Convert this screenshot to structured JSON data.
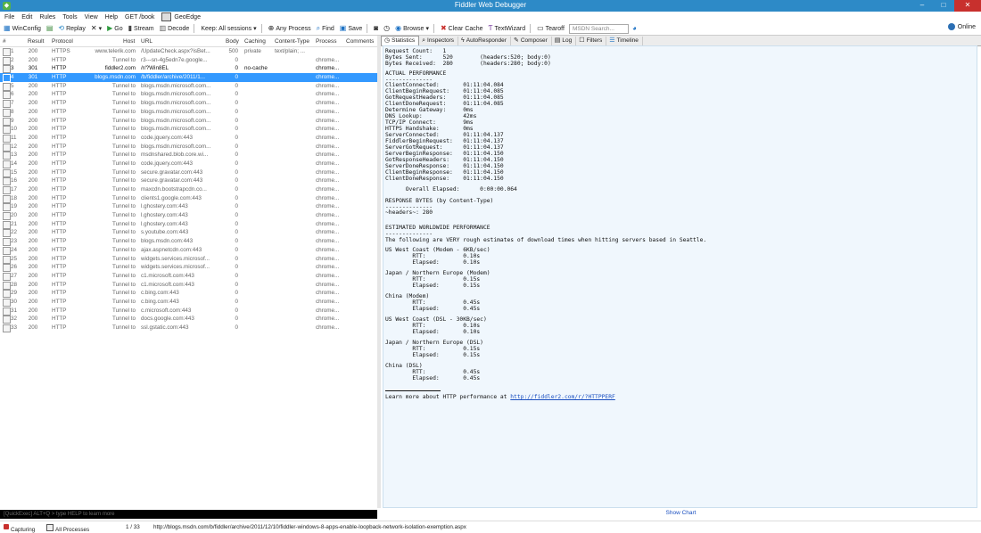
{
  "window": {
    "title": "Fiddler Web Debugger"
  },
  "menu": [
    "File",
    "Edit",
    "Rules",
    "Tools",
    "View",
    "Help",
    "GET /book",
    "GeoEdge"
  ],
  "toolbar": {
    "winconfig": "WinConfig",
    "replay": "Replay",
    "go": "Go",
    "stream": "Stream",
    "decode": "Decode",
    "keep": "Keep: All sessions",
    "any_process": "Any Process",
    "find": "Find",
    "save": "Save",
    "browse": "Browse",
    "clear_cache": "Clear Cache",
    "textwizard": "TextWizard",
    "tearoff": "Tearoff",
    "search_placeholder": "MSDN Search...",
    "online": "Online"
  },
  "sessions": {
    "columns": {
      "num": "#",
      "result": "Result",
      "protocol": "Protocol",
      "host": "Host",
      "url": "URL",
      "body": "Body",
      "caching": "Caching",
      "content_type": "Content-Type",
      "process": "Process",
      "comments": "Comments"
    },
    "rows": [
      {
        "id": "1",
        "result": "200",
        "protocol": "HTTPS",
        "host": "www.telerik.com",
        "url": "/UpdateCheck.aspx?isBet...",
        "body": "500",
        "caching": "private",
        "ctype": "text/plain; ...",
        "process": "",
        "style": ""
      },
      {
        "id": "2",
        "result": "200",
        "protocol": "HTTP",
        "host": "Tunnel to",
        "url": "r3---sn-4g5edn7e.google...",
        "body": "0",
        "caching": "",
        "ctype": "",
        "process": "chrome...",
        "style": ""
      },
      {
        "id": "3",
        "result": "301",
        "protocol": "HTTP",
        "host": "fiddler2.com",
        "url": "/r/?Win8EL",
        "body": "0",
        "caching": "no-cache",
        "ctype": "",
        "process": "chrome...",
        "style": "black"
      },
      {
        "id": "4",
        "result": "301",
        "protocol": "HTTP",
        "host": "blogs.msdn.com",
        "url": "/b/fiddler/archive/2011/1...",
        "body": "0",
        "caching": "",
        "ctype": "",
        "process": "chrome...",
        "style": "sel"
      },
      {
        "id": "5",
        "result": "200",
        "protocol": "HTTP",
        "host": "Tunnel to",
        "url": "blogs.msdn.microsoft.com...",
        "body": "0",
        "caching": "",
        "ctype": "",
        "process": "chrome...",
        "style": ""
      },
      {
        "id": "6",
        "result": "200",
        "protocol": "HTTP",
        "host": "Tunnel to",
        "url": "blogs.msdn.microsoft.com...",
        "body": "0",
        "caching": "",
        "ctype": "",
        "process": "chrome...",
        "style": ""
      },
      {
        "id": "7",
        "result": "200",
        "protocol": "HTTP",
        "host": "Tunnel to",
        "url": "blogs.msdn.microsoft.com...",
        "body": "0",
        "caching": "",
        "ctype": "",
        "process": "chrome...",
        "style": ""
      },
      {
        "id": "8",
        "result": "200",
        "protocol": "HTTP",
        "host": "Tunnel to",
        "url": "blogs.msdn.microsoft.com...",
        "body": "0",
        "caching": "",
        "ctype": "",
        "process": "chrome...",
        "style": ""
      },
      {
        "id": "9",
        "result": "200",
        "protocol": "HTTP",
        "host": "Tunnel to",
        "url": "blogs.msdn.microsoft.com...",
        "body": "0",
        "caching": "",
        "ctype": "",
        "process": "chrome...",
        "style": ""
      },
      {
        "id": "10",
        "result": "200",
        "protocol": "HTTP",
        "host": "Tunnel to",
        "url": "blogs.msdn.microsoft.com...",
        "body": "0",
        "caching": "",
        "ctype": "",
        "process": "chrome...",
        "style": ""
      },
      {
        "id": "11",
        "result": "200",
        "protocol": "HTTP",
        "host": "Tunnel to",
        "url": "code.jquery.com:443",
        "body": "0",
        "caching": "",
        "ctype": "",
        "process": "chrome...",
        "style": ""
      },
      {
        "id": "12",
        "result": "200",
        "protocol": "HTTP",
        "host": "Tunnel to",
        "url": "blogs.msdn.microsoft.com...",
        "body": "0",
        "caching": "",
        "ctype": "",
        "process": "chrome...",
        "style": ""
      },
      {
        "id": "13",
        "result": "200",
        "protocol": "HTTP",
        "host": "Tunnel to",
        "url": "msdnshared.blob.core.wi...",
        "body": "0",
        "caching": "",
        "ctype": "",
        "process": "chrome...",
        "style": ""
      },
      {
        "id": "14",
        "result": "200",
        "protocol": "HTTP",
        "host": "Tunnel to",
        "url": "code.jquery.com:443",
        "body": "0",
        "caching": "",
        "ctype": "",
        "process": "chrome...",
        "style": ""
      },
      {
        "id": "15",
        "result": "200",
        "protocol": "HTTP",
        "host": "Tunnel to",
        "url": "secure.gravatar.com:443",
        "body": "0",
        "caching": "",
        "ctype": "",
        "process": "chrome...",
        "style": ""
      },
      {
        "id": "16",
        "result": "200",
        "protocol": "HTTP",
        "host": "Tunnel to",
        "url": "secure.gravatar.com:443",
        "body": "0",
        "caching": "",
        "ctype": "",
        "process": "chrome...",
        "style": ""
      },
      {
        "id": "17",
        "result": "200",
        "protocol": "HTTP",
        "host": "Tunnel to",
        "url": "maxcdn.bootstrapcdn.co...",
        "body": "0",
        "caching": "",
        "ctype": "",
        "process": "chrome...",
        "style": ""
      },
      {
        "id": "18",
        "result": "200",
        "protocol": "HTTP",
        "host": "Tunnel to",
        "url": "clients1.google.com:443",
        "body": "0",
        "caching": "",
        "ctype": "",
        "process": "chrome...",
        "style": ""
      },
      {
        "id": "19",
        "result": "200",
        "protocol": "HTTP",
        "host": "Tunnel to",
        "url": "l.ghostery.com:443",
        "body": "0",
        "caching": "",
        "ctype": "",
        "process": "chrome...",
        "style": ""
      },
      {
        "id": "20",
        "result": "200",
        "protocol": "HTTP",
        "host": "Tunnel to",
        "url": "l.ghostery.com:443",
        "body": "0",
        "caching": "",
        "ctype": "",
        "process": "chrome...",
        "style": ""
      },
      {
        "id": "21",
        "result": "200",
        "protocol": "HTTP",
        "host": "Tunnel to",
        "url": "l.ghostery.com:443",
        "body": "0",
        "caching": "",
        "ctype": "",
        "process": "chrome...",
        "style": ""
      },
      {
        "id": "22",
        "result": "200",
        "protocol": "HTTP",
        "host": "Tunnel to",
        "url": "s.youtube.com:443",
        "body": "0",
        "caching": "",
        "ctype": "",
        "process": "chrome...",
        "style": ""
      },
      {
        "id": "23",
        "result": "200",
        "protocol": "HTTP",
        "host": "Tunnel to",
        "url": "blogs.msdn.com:443",
        "body": "0",
        "caching": "",
        "ctype": "",
        "process": "chrome...",
        "style": ""
      },
      {
        "id": "24",
        "result": "200",
        "protocol": "HTTP",
        "host": "Tunnel to",
        "url": "ajax.aspnetcdn.com:443",
        "body": "0",
        "caching": "",
        "ctype": "",
        "process": "chrome...",
        "style": ""
      },
      {
        "id": "25",
        "result": "200",
        "protocol": "HTTP",
        "host": "Tunnel to",
        "url": "widgets.services.microsof...",
        "body": "0",
        "caching": "",
        "ctype": "",
        "process": "chrome...",
        "style": ""
      },
      {
        "id": "26",
        "result": "200",
        "protocol": "HTTP",
        "host": "Tunnel to",
        "url": "widgets.services.microsof...",
        "body": "0",
        "caching": "",
        "ctype": "",
        "process": "chrome...",
        "style": ""
      },
      {
        "id": "27",
        "result": "200",
        "protocol": "HTTP",
        "host": "Tunnel to",
        "url": "c1.microsoft.com:443",
        "body": "0",
        "caching": "",
        "ctype": "",
        "process": "chrome...",
        "style": ""
      },
      {
        "id": "28",
        "result": "200",
        "protocol": "HTTP",
        "host": "Tunnel to",
        "url": "c1.microsoft.com:443",
        "body": "0",
        "caching": "",
        "ctype": "",
        "process": "chrome...",
        "style": ""
      },
      {
        "id": "29",
        "result": "200",
        "protocol": "HTTP",
        "host": "Tunnel to",
        "url": "c.bing.com:443",
        "body": "0",
        "caching": "",
        "ctype": "",
        "process": "chrome...",
        "style": ""
      },
      {
        "id": "30",
        "result": "200",
        "protocol": "HTTP",
        "host": "Tunnel to",
        "url": "c.bing.com:443",
        "body": "0",
        "caching": "",
        "ctype": "",
        "process": "chrome...",
        "style": ""
      },
      {
        "id": "31",
        "result": "200",
        "protocol": "HTTP",
        "host": "Tunnel to",
        "url": "c.microsoft.com:443",
        "body": "0",
        "caching": "",
        "ctype": "",
        "process": "chrome...",
        "style": ""
      },
      {
        "id": "32",
        "result": "200",
        "protocol": "HTTP",
        "host": "Tunnel to",
        "url": "docs.google.com:443",
        "body": "0",
        "caching": "",
        "ctype": "",
        "process": "chrome...",
        "style": ""
      },
      {
        "id": "33",
        "result": "200",
        "protocol": "HTTP",
        "host": "Tunnel to",
        "url": "ssl.gstatic.com:443",
        "body": "0",
        "caching": "",
        "ctype": "",
        "process": "chrome...",
        "style": ""
      }
    ]
  },
  "quickexec": "[QuickExec] ALT+Q > type HELP to learn more",
  "inspector_tabs": [
    "Statistics",
    "Inspectors",
    "AutoResponder",
    "Composer",
    "Log",
    "Filters",
    "Timeline"
  ],
  "stats": {
    "req_count": "Request Count:   1",
    "bytes_sent": "Bytes Sent:      520        (headers:520; body:0)",
    "bytes_received": "Bytes Received:  280        (headers:280; body:0)",
    "actual_title": "ACTUAL PERFORMANCE",
    "dash1": "--------------",
    "client_connected": "ClientConnected:       01:11:04.084",
    "client_begin_request": "ClientBeginRequest:    01:11:04.085",
    "got_request_headers": "GotRequestHeaders:     01:11:04.085",
    "client_done_request": "ClientDoneRequest:     01:11:04.085",
    "determine_gateway": "Determine Gateway:     0ms",
    "dns_lookup": "DNS Lookup:            42ms",
    "tcpip_connect": "TCP/IP Connect:        9ms",
    "https_handshake": "HTTPS Handshake:       0ms",
    "server_connected": "ServerConnected:       01:11:04.137",
    "fiddler_begin_request": "FiddlerBeginRequest:   01:11:04.137",
    "server_got_request": "ServerGotRequest:      01:11:04.137",
    "server_begin_response": "ServerBeginResponse:   01:11:04.150",
    "got_response_headers": "GotResponseHeaders:    01:11:04.150",
    "server_done_response": "ServerDoneResponse:    01:11:04.150",
    "client_begin_response": "ClientBeginResponse:   01:11:04.150",
    "client_done_response": "ClientDoneResponse:    01:11:04.150",
    "overall_elapsed": "      Overall Elapsed:      0:00:00.064",
    "bytes_title": "RESPONSE BYTES (by Content-Type)",
    "dash2": "--------------",
    "headers_bytes": "~headers~: 280",
    "est_title": "ESTIMATED WORLDWIDE PERFORMANCE",
    "dash3": "--------------",
    "est_note": "The following are VERY rough estimates of download times when hitting servers based in Seattle.",
    "us_modem": "US West Coast (Modem - 6KB/sec)",
    "us_modem_rtt": "        RTT:           0.10s",
    "us_modem_elapsed": "        Elapsed:       0.10s",
    "jp_modem": "Japan / Northern Europe (Modem)",
    "jp_modem_rtt": "        RTT:           0.15s",
    "jp_modem_elapsed": "        Elapsed:       0.15s",
    "cn_modem": "China (Modem)",
    "cn_modem_rtt": "        RTT:           0.45s",
    "cn_modem_elapsed": "        Elapsed:       0.45s",
    "us_dsl": "US West Coast (DSL - 30KB/sec)",
    "us_dsl_rtt": "        RTT:           0.10s",
    "us_dsl_elapsed": "        Elapsed:       0.10s",
    "jp_dsl": "Japan / Northern Europe (DSL)",
    "jp_dsl_rtt": "        RTT:           0.15s",
    "jp_dsl_elapsed": "        Elapsed:       0.15s",
    "cn_dsl": "China (DSL)",
    "cn_dsl_rtt": "        RTT:           0.45s",
    "cn_dsl_elapsed": "        Elapsed:       0.45s",
    "learn_more": "Learn more about HTTP performance at ",
    "learn_link": "http://fiddler2.com/r/?HTTPPERF"
  },
  "show_chart": "Show Chart",
  "status": {
    "capturing": "Capturing",
    "processes": "All Processes",
    "count": "1 / 33",
    "url": "http://blogs.msdn.com/b/fiddler/archive/2011/12/10/fiddler-windows-8-apps-enable-loopback-network-isolation-exemption.aspx"
  },
  "colors": {
    "titlebar": "#2d8ac7",
    "selection": "#3399ff",
    "stats_bg": "#f0f7fd",
    "link": "#1a4fc0",
    "close": "#c8302d"
  }
}
